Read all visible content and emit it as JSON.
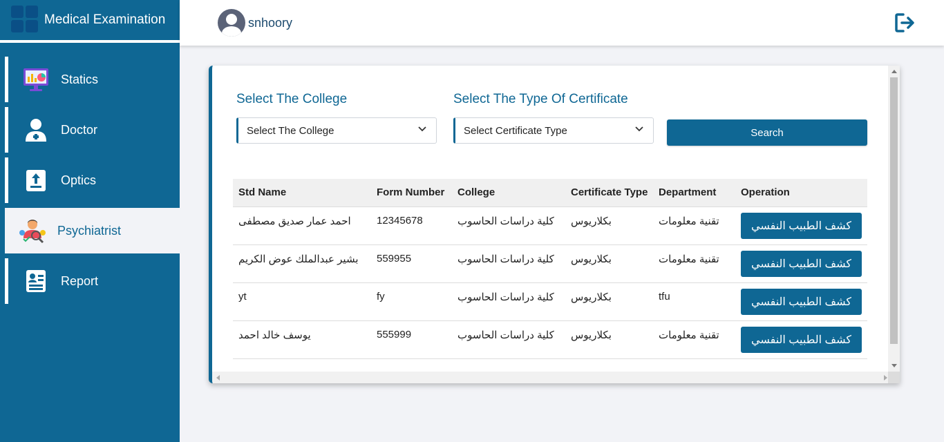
{
  "brand": {
    "title": "Medical Examination"
  },
  "user": {
    "name": "snhoory"
  },
  "nav": [
    {
      "label": "Statics",
      "icon": "monitor-chart-icon"
    },
    {
      "label": "Doctor",
      "icon": "doctor-icon"
    },
    {
      "label": "Optics",
      "icon": "upload-clipboard-icon"
    },
    {
      "label": "Psychiatrist",
      "icon": "psychiatrist-icon",
      "active": true
    },
    {
      "label": "Report",
      "icon": "report-icon"
    }
  ],
  "filters": {
    "college_label": "Select The College",
    "college_value": "Select The College",
    "certificate_label": "Select The Type Of Certificate",
    "certificate_value": "Select Certificate Type",
    "search_label": "Search"
  },
  "table": {
    "headers": [
      "Std Name",
      "Form Number",
      "College",
      "Certificate Type",
      "Department",
      "Operation"
    ],
    "rows": [
      {
        "name": "احمد عمار صديق مصطفى",
        "form": "12345678",
        "college": "كلية دراسات الحاسوب",
        "cert": "بكلاريوس",
        "dept": "تقنية معلومات",
        "op": "كشف الطبيب النفسي"
      },
      {
        "name": "بشير عبدالملك عوض الكريم",
        "form": "559955",
        "college": "كلية دراسات الحاسوب",
        "cert": "بكلاريوس",
        "dept": "تقنية معلومات",
        "op": "كشف الطبيب النفسي"
      },
      {
        "name": "yt",
        "form": "fy",
        "college": "كلية دراسات الحاسوب",
        "cert": "بكلاريوس",
        "dept": "tfu",
        "op": "كشف الطبيب النفسي"
      },
      {
        "name": "يوسف خالد احمد",
        "form": "555999",
        "college": "كلية دراسات الحاسوب",
        "cert": "بكلاريوس",
        "dept": "تقنية معلومات",
        "op": "كشف الطبيب النفسي"
      }
    ]
  },
  "colors": {
    "primary": "#0f6794",
    "background": "#f2f3f7"
  }
}
